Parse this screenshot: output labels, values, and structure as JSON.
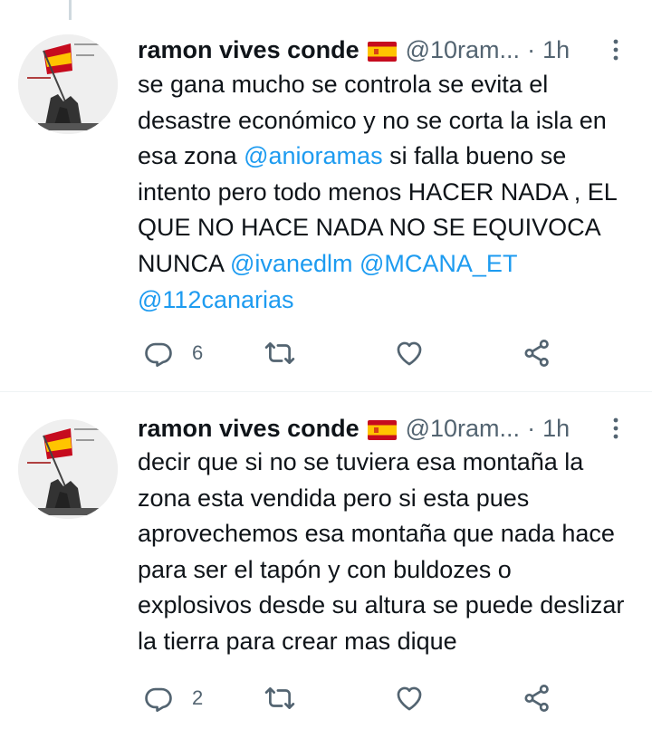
{
  "tweets": [
    {
      "author": {
        "name": "ramon vives conde",
        "flag": "spain-flag",
        "handle": "@10ram...",
        "time": "1h"
      },
      "separator": "·",
      "body_segments": [
        {
          "text": "se gana mucho se controla se evita el desastre económico y no se corta la isla en esa zona ",
          "type": "text"
        },
        {
          "text": "@anioramas",
          "type": "mention"
        },
        {
          "text": " si falla bueno se intento pero todo menos HACER NADA , EL QUE NO HACE NADA NO SE EQUIVOCA NUNCA ",
          "type": "text"
        },
        {
          "text": "@ivanedlm",
          "type": "mention"
        },
        {
          "text": " ",
          "type": "text"
        },
        {
          "text": "@MCANA_ET",
          "type": "mention"
        },
        {
          "text": " ",
          "type": "text"
        },
        {
          "text": "@112canarias",
          "type": "mention"
        }
      ],
      "actions": {
        "reply_count": "6",
        "retweet_count": "",
        "like_count": ""
      }
    },
    {
      "author": {
        "name": "ramon vives conde",
        "flag": "spain-flag",
        "handle": "@10ram...",
        "time": "1h"
      },
      "separator": "·",
      "body_segments": [
        {
          "text": "decir que si no se tuviera esa montaña la zona esta vendida pero si esta pues aprovechemos esa montaña que nada hace para ser el tapón y con buldozes o explosivos desde su altura se puede deslizar la tierra para crear mas dique",
          "type": "text"
        }
      ],
      "actions": {
        "reply_count": "2",
        "retweet_count": "",
        "like_count": ""
      }
    }
  ],
  "icons": {
    "reply": "reply-icon",
    "retweet": "retweet-icon",
    "like": "heart-icon",
    "share": "share-icon",
    "more": "more-vertical-icon"
  },
  "colors": {
    "mention": "#1d9bf0",
    "muted": "#536471",
    "text": "#0f1419",
    "flag_red": "#c60b1e",
    "flag_yellow": "#ffc400"
  }
}
